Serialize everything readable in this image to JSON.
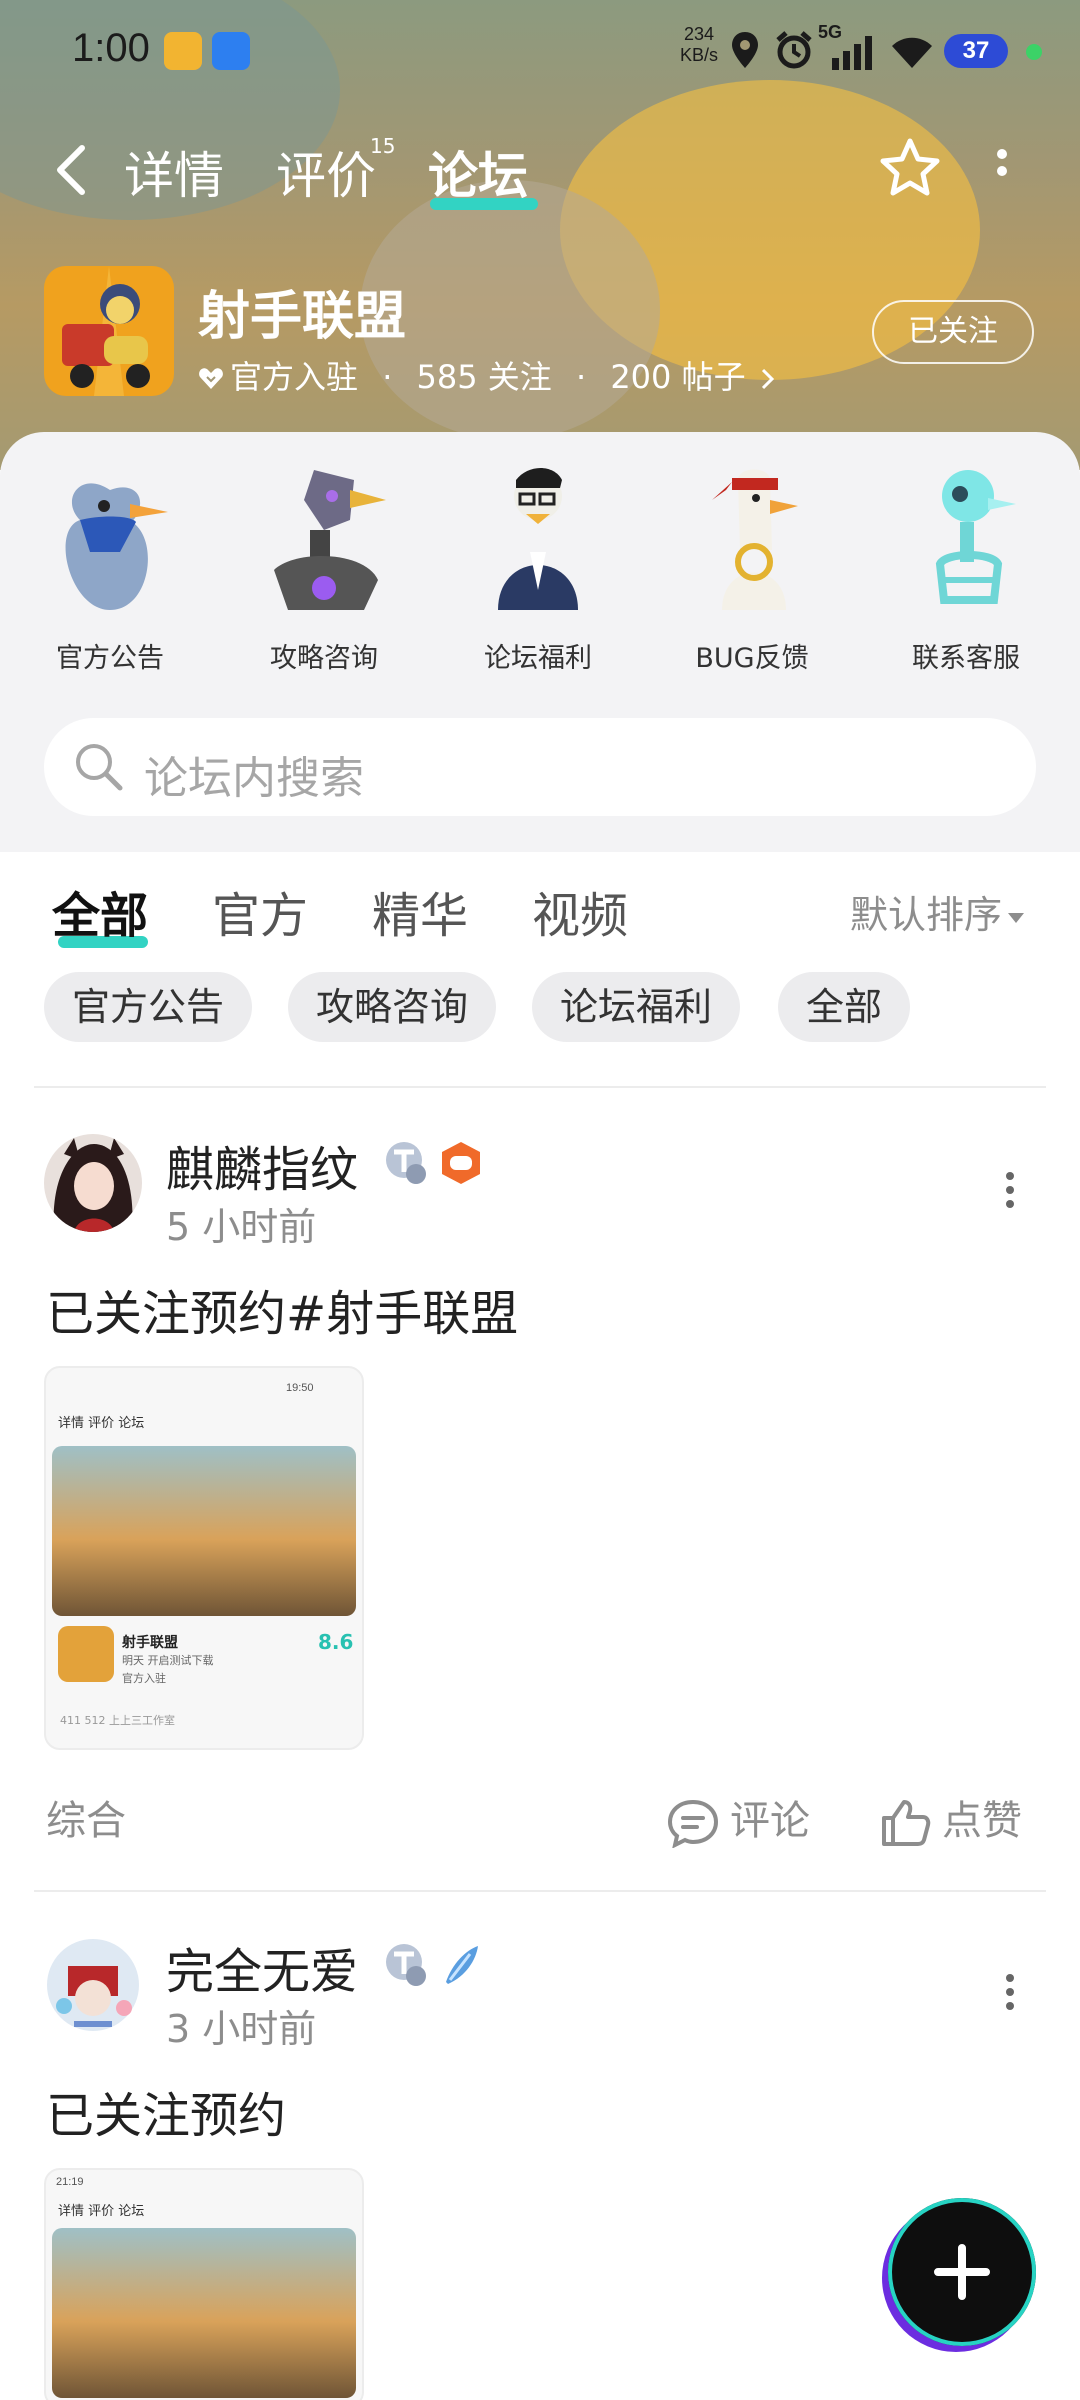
{
  "status_bar": {
    "time": "1:00",
    "speed_value": "234",
    "speed_unit": "KB/s",
    "network": "5G",
    "battery": "37"
  },
  "nav": {
    "tabs": [
      {
        "label": "详情",
        "active": false
      },
      {
        "label": "评价",
        "active": false,
        "superscript": "15"
      },
      {
        "label": "论坛",
        "active": true
      }
    ],
    "accent": "#32d3c3"
  },
  "game": {
    "title": "射手联盟",
    "official_tag": "官方入驻",
    "meta_separator_1": "·",
    "followers": "585 关注",
    "meta_separator_2": "·",
    "posts": "200 帖子",
    "follow_button": "已关注"
  },
  "categories": [
    {
      "label": "官方公告",
      "icon": "gull-mascot-icon"
    },
    {
      "label": "攻略咨询",
      "icon": "robot-goose-icon"
    },
    {
      "label": "论坛福利",
      "icon": "goose-with-glasses-icon"
    },
    {
      "label": "BUG反馈",
      "icon": "goose-with-headband-icon"
    },
    {
      "label": "联系客服",
      "icon": "skeleton-goose-icon"
    }
  ],
  "search": {
    "placeholder": "论坛内搜索"
  },
  "feed_tabs": [
    {
      "label": "全部",
      "active": true
    },
    {
      "label": "官方",
      "active": false
    },
    {
      "label": "精华",
      "active": false
    },
    {
      "label": "视频",
      "active": false
    }
  ],
  "sort_label": "默认排序",
  "chips": [
    "官方公告",
    "攻略咨询",
    "论坛福利",
    "全部"
  ],
  "posts": [
    {
      "author": "麒麟指纹",
      "time": "5 小时前",
      "text": "已关注预约#射手联盟",
      "category": "综合",
      "comment_label": "评论",
      "like_label": "点赞",
      "thumb": {
        "nav": "详情   评价   论坛",
        "time": "19:50",
        "game_name": "射手联盟",
        "game_sub": "明天 开启测试下载",
        "official": "官方入驻",
        "score": "8.6",
        "stats": "411       512       上上三工作室"
      }
    },
    {
      "author": "完全无爱",
      "time": "3 小时前",
      "text": "已关注预约",
      "thumb": {
        "time": "21:19",
        "nav": "详情   评价   论坛"
      }
    }
  ]
}
